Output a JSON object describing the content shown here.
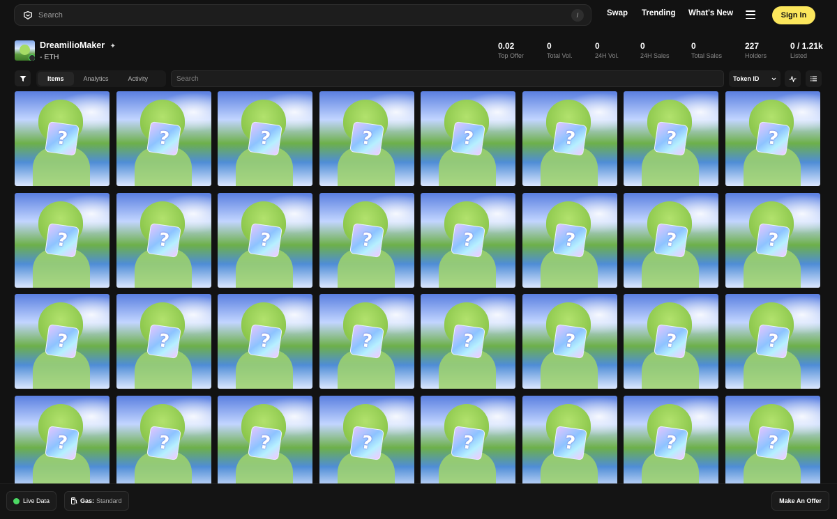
{
  "header": {
    "search_placeholder": "Search",
    "search_shortcut": "/",
    "nav": [
      "Swap",
      "Trending",
      "What's New"
    ],
    "signin_label": "Sign In",
    "accent_color": "#fbe65c"
  },
  "collection": {
    "name": "DreamilioMaker",
    "chain": "- ETH",
    "stats": [
      {
        "value": "0.02",
        "label": "Top Offer"
      },
      {
        "value": "0",
        "label": "Total Vol."
      },
      {
        "value": "0",
        "label": "24H Vol."
      },
      {
        "value": "0",
        "label": "24H Sales"
      },
      {
        "value": "0",
        "label": "Total Sales"
      },
      {
        "value": "227",
        "label": "Holders"
      },
      {
        "value": "0 / 1.21k",
        "label": "Listed"
      }
    ]
  },
  "toolbar": {
    "tabs": [
      "Items",
      "Analytics",
      "Activity"
    ],
    "active_tab": "Items",
    "search_placeholder": "Search",
    "sort_label": "Token ID"
  },
  "grid": {
    "item_count": 32,
    "columns": 8,
    "item_art": "mystery-box-placeholder"
  },
  "footer": {
    "live_label": "Live Data",
    "gas_label": "Gas:",
    "gas_value": "Standard",
    "offer_label": "Make An Offer",
    "live_color": "#4cd964"
  }
}
